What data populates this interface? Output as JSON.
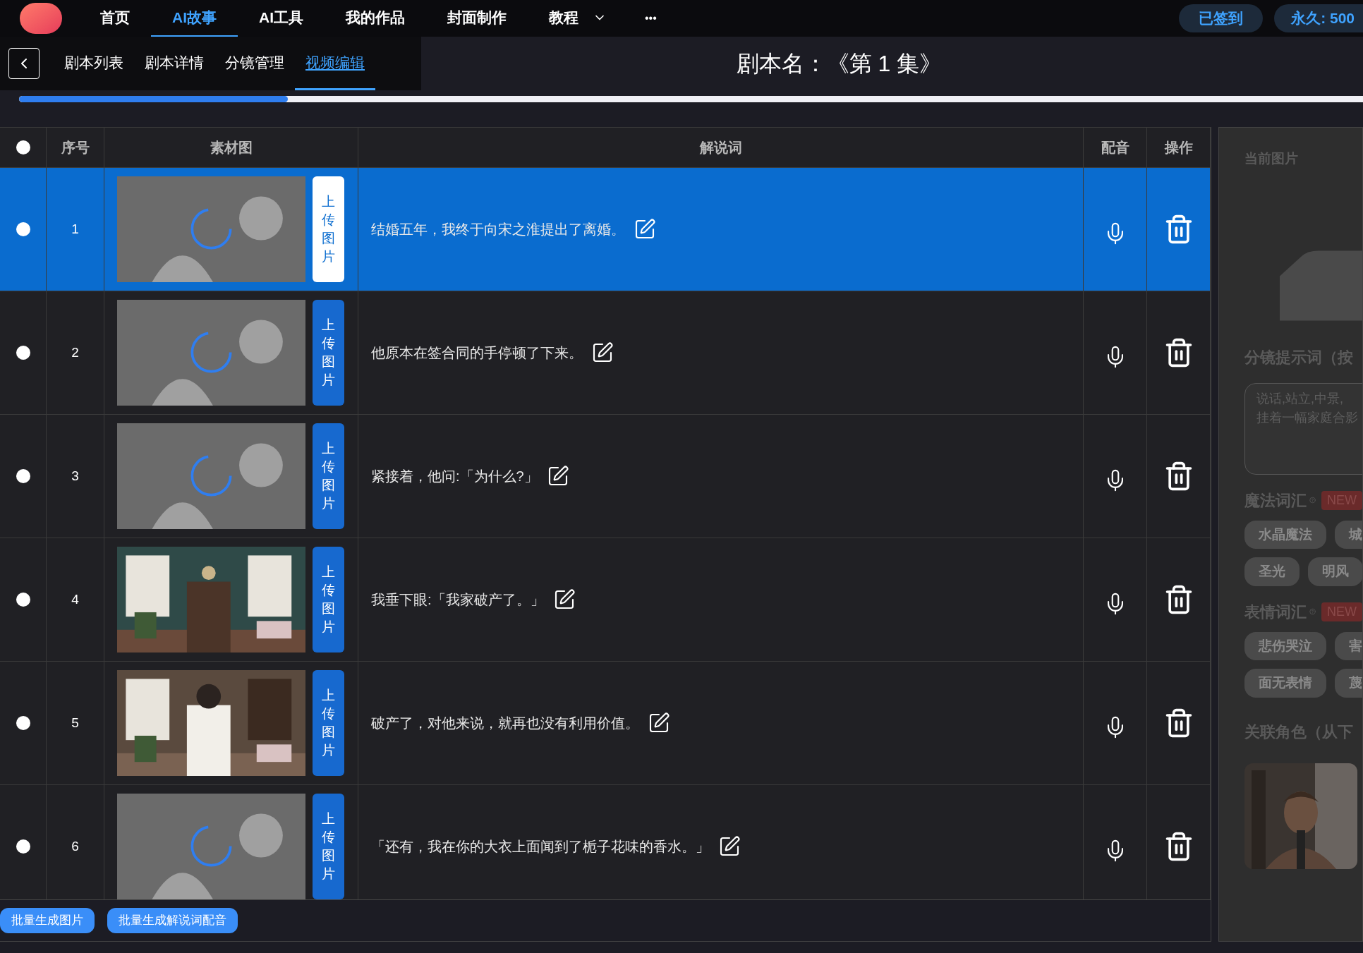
{
  "nav": {
    "items": [
      {
        "label": "首页",
        "selected": false
      },
      {
        "label": "AI故事",
        "selected": true
      },
      {
        "label": "AI工具",
        "selected": false
      },
      {
        "label": "我的作品",
        "selected": false
      },
      {
        "label": "封面制作",
        "selected": false
      },
      {
        "label": "教程",
        "selected": false,
        "dropdown": true
      }
    ],
    "more": "•••",
    "signin": "已签到",
    "points": "永久: 500"
  },
  "tabs": [
    {
      "label": "剧本列表",
      "selected": false
    },
    {
      "label": "剧本详情",
      "selected": false
    },
    {
      "label": "分镜管理",
      "selected": false
    },
    {
      "label": "视频编辑",
      "selected": true
    }
  ],
  "title": "剧本名：《第 1 集》",
  "progress": {
    "level": 0.2
  },
  "table": {
    "select_all": {
      "checked": false
    },
    "columns": [
      "序号",
      "素材图",
      "解说词",
      "配音",
      "操作"
    ],
    "rows": [
      {
        "index": "1",
        "selected": true,
        "kind": "loading",
        "upload": "上传图片",
        "text": "结婚五年，我终于向宋之淮提出了离婚。"
      },
      {
        "index": "2",
        "selected": false,
        "kind": "loading",
        "upload": "上传图片",
        "text": "他原本在签合同的手停顿了下来。"
      },
      {
        "index": "3",
        "selected": false,
        "kind": "loading",
        "upload": "上传图片",
        "text": "紧接着，他问:「为什么?」"
      },
      {
        "index": "4",
        "selected": false,
        "kind": "picture",
        "upload": "上传图片",
        "text": "我垂下眼:「我家破产了。」"
      },
      {
        "index": "5",
        "selected": false,
        "kind": "picture",
        "upload": "上传图片",
        "text": "破产了，对他来说，就再也没有利用价值。"
      },
      {
        "index": "6",
        "selected": false,
        "kind": "loading",
        "upload": "上传图片",
        "text": "「还有，我在你的大衣上面闻到了栀子花味的香水。」"
      }
    ]
  },
  "buttons": [
    "批量生成图片",
    "批量生成解说词配音"
  ],
  "panel": {
    "current_image": "当前图片",
    "prompt_label": "分镜提示词（按",
    "prompt_lines": [
      "说话,站立,中景,",
      "挂着一幅家庭合影"
    ],
    "magic": {
      "label": "魔法词汇",
      "badge": "NEW",
      "tags": [
        [
          "水晶魔法",
          "城"
        ],
        [
          "圣光",
          "明风"
        ]
      ]
    },
    "emotion": {
      "label": "表情词汇",
      "badge": "NEW",
      "tags": [
        [
          "悲伤哭泣",
          "害"
        ],
        [
          "面无表情",
          "蔑"
        ]
      ]
    },
    "character_label": "关联角色（从下"
  }
}
